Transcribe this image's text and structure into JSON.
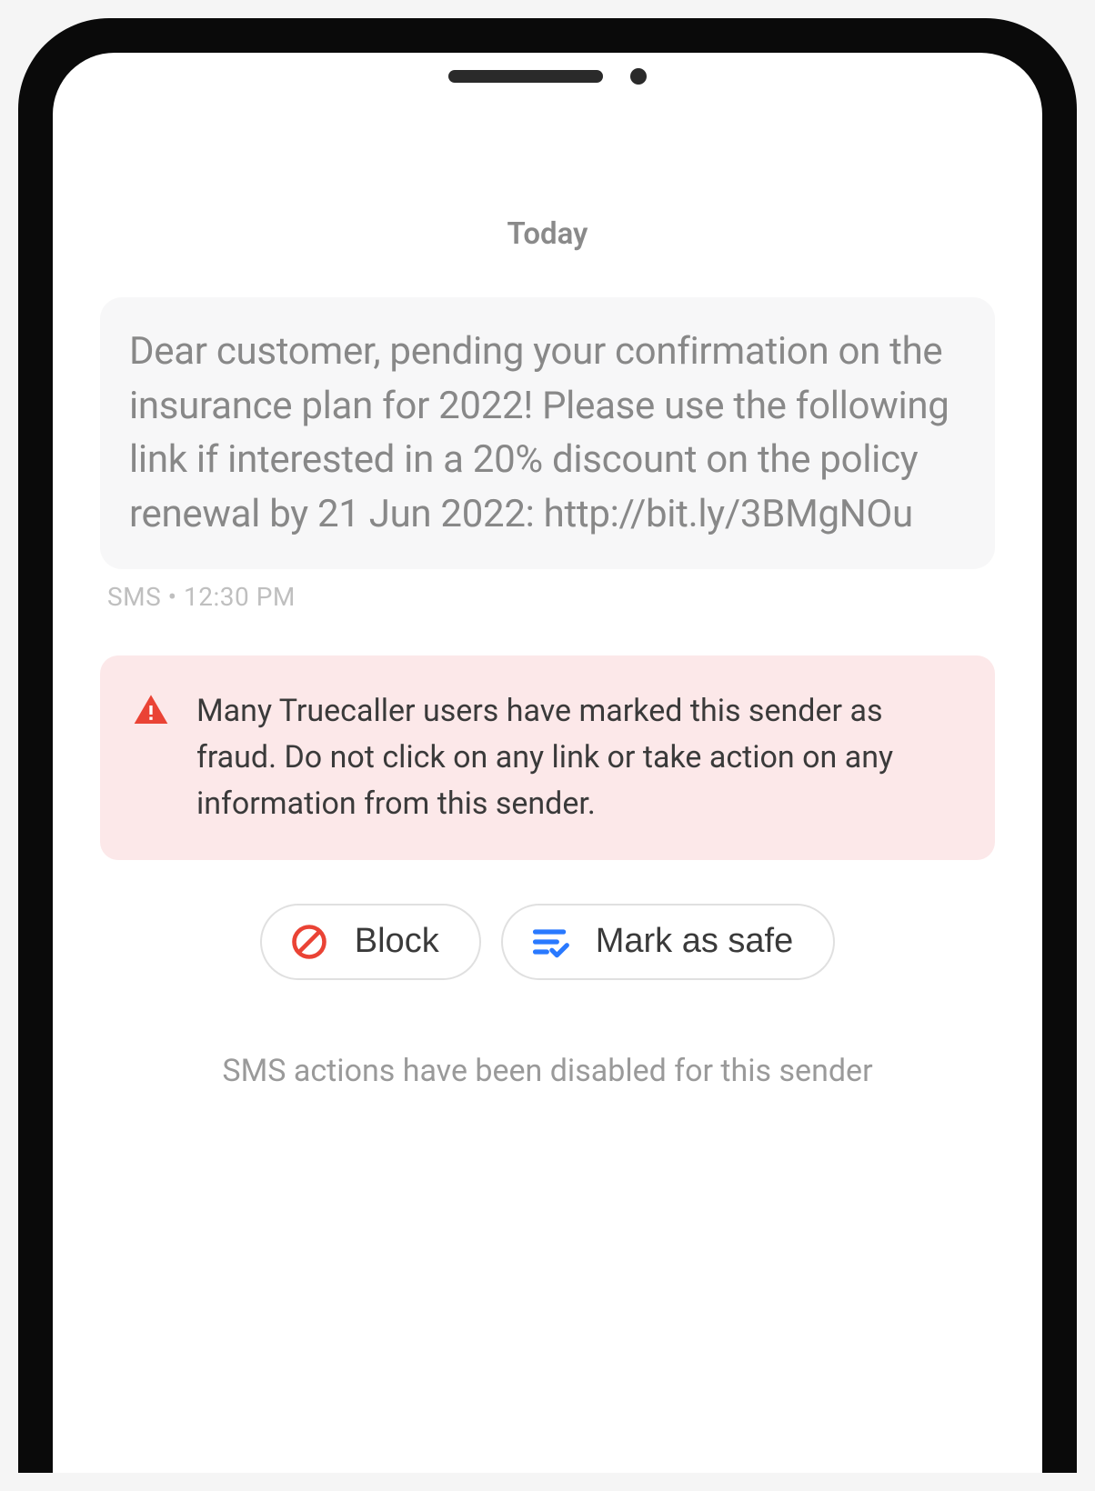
{
  "date_label": "Today",
  "message": {
    "text": "Dear customer, pending your confirmation on the insurance plan for 2022! Please use the following link if interested in a 20% discount on the policy renewal by 21 Jun 2022: http://bit.ly/3BMgNOu",
    "meta": "SMS • 12:30 PM"
  },
  "warning": {
    "text": "Many Truecaller users have marked this sender as fraud. Do not click on any link or take action on any information from this sender."
  },
  "actions": {
    "block_label": "Block",
    "mark_safe_label": "Mark as safe"
  },
  "disabled_notice": "SMS actions have been disabled for this sender"
}
